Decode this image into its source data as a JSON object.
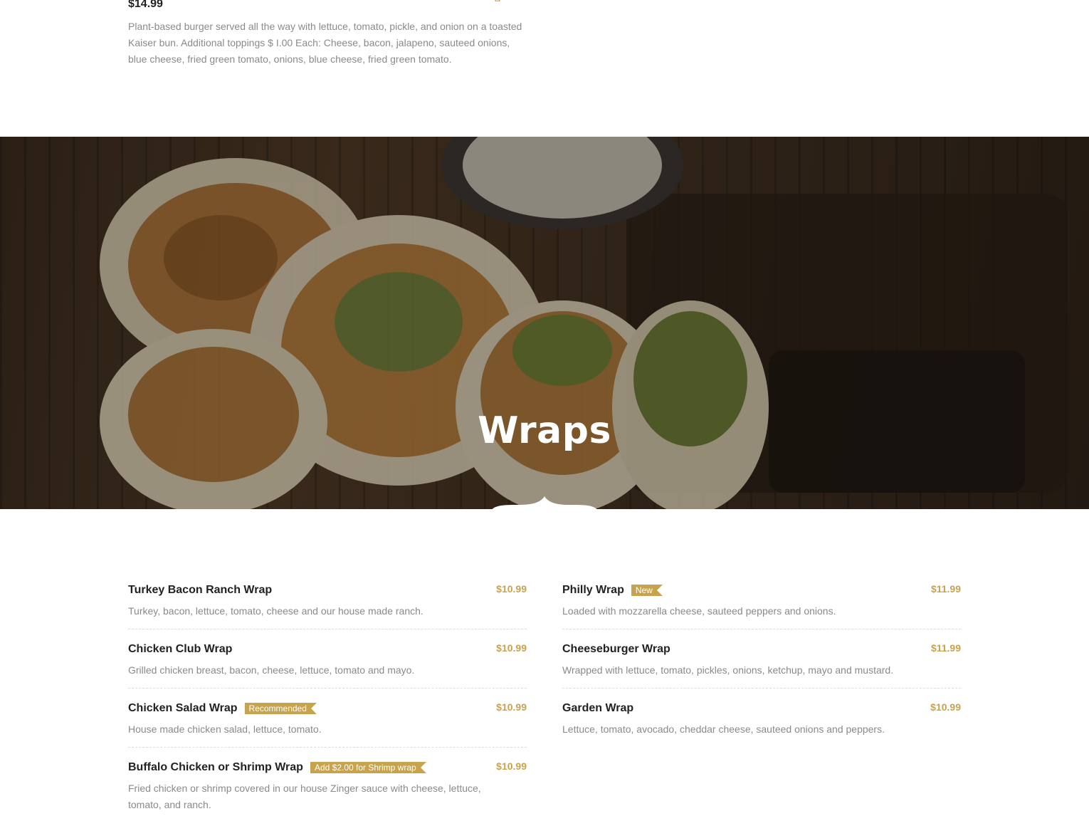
{
  "previous_section": {
    "price": "$14.99",
    "description": "Plant-based burger served all the way with lettuce, tomato, pickle, and onion on a toasted Kaiser bun. Additional toppings $ I.00 Each: Cheese, bacon, jalapeno, sauteed onions, blue cheese, fried green tomato, onions, blue cheese, fried green tomato."
  },
  "banner": {
    "title": "Wraps"
  },
  "colors": {
    "accent": "#c7a34e",
    "heading": "#222222",
    "body_text": "#8a8a8a"
  },
  "menu": {
    "left": [
      {
        "name": "Turkey Bacon Ranch Wrap",
        "tag": "",
        "price": "$10.99",
        "description": "Turkey, bacon, lettuce, tomato, cheese and our house made ranch."
      },
      {
        "name": "Chicken Club Wrap",
        "tag": "",
        "price": "$10.99",
        "description": "Grilled chicken breast, bacon, cheese, lettuce, tomato and mayo."
      },
      {
        "name": "Chicken Salad Wrap",
        "tag": "Recommended",
        "price": "$10.99",
        "description": "House made chicken salad, lettuce, tomato."
      },
      {
        "name": "Buffalo Chicken or Shrimp Wrap",
        "tag": "Add $2.00 for Shrimp wrap",
        "price": "$10.99",
        "description": "Fried chicken or shrimp covered in our house Zinger sauce with cheese, lettuce, tomato, and ranch."
      }
    ],
    "right": [
      {
        "name": "Philly Wrap",
        "tag": "New",
        "price": "$11.99",
        "description": "Loaded with mozzarella cheese, sauteed peppers and onions."
      },
      {
        "name": "Cheeseburger Wrap",
        "tag": "",
        "price": "$11.99",
        "description": "Wrapped with lettuce, tomato, pickles, onions, ketchup, mayo and mustard."
      },
      {
        "name": "Garden Wrap",
        "tag": "",
        "price": "$10.99",
        "description": "Lettuce, tomato, avocado, cheddar cheese, sauteed onions and peppers."
      }
    ]
  }
}
